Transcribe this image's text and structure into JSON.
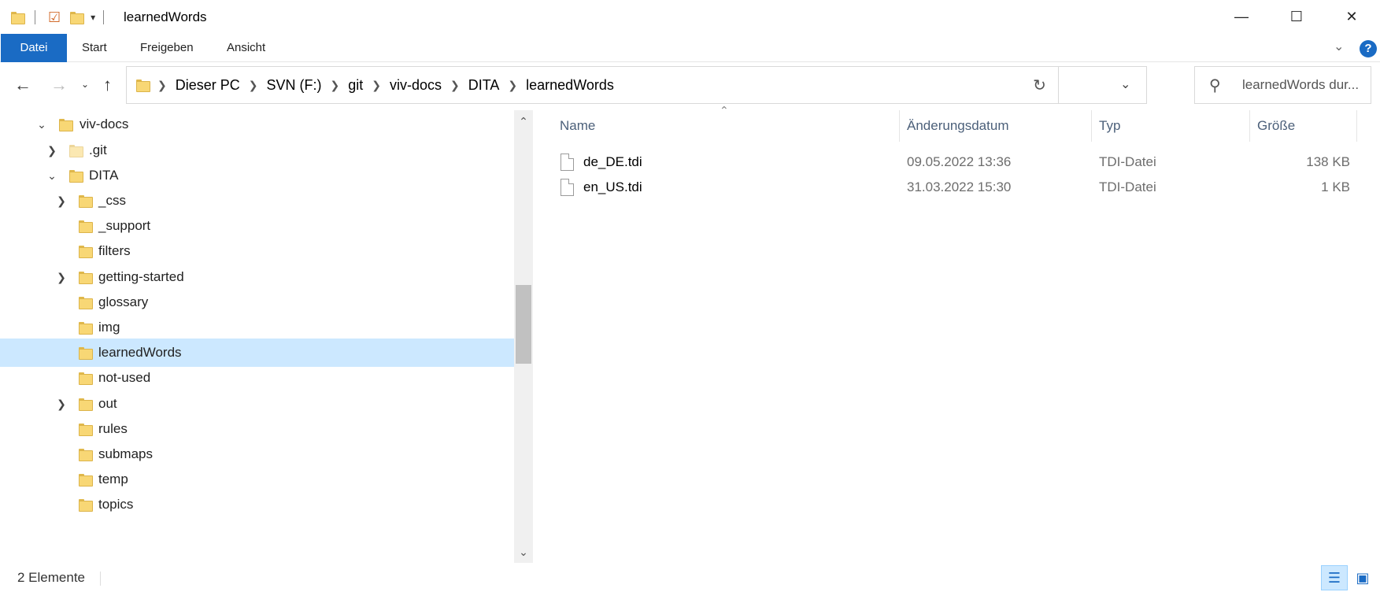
{
  "window": {
    "title": "learnedWords",
    "minimize_glyph": "—",
    "maximize_glyph": "☐",
    "close_glyph": "✕"
  },
  "ribbon": {
    "tabs": [
      {
        "label": "Datei",
        "active": true
      },
      {
        "label": "Start",
        "active": false
      },
      {
        "label": "Freigeben",
        "active": false
      },
      {
        "label": "Ansicht",
        "active": false
      }
    ],
    "help_label": "?"
  },
  "address": {
    "crumbs": [
      "Dieser PC",
      "SVN (F:)",
      "git",
      "viv-docs",
      "DITA",
      "learnedWords"
    ]
  },
  "search": {
    "placeholder": "learnedWords dur..."
  },
  "tree": [
    {
      "label": "viv-docs",
      "expander": "expanded"
    },
    {
      "label": ".git",
      "expander": "collapsed"
    },
    {
      "label": "DITA",
      "expander": "expanded"
    },
    {
      "label": "_css",
      "expander": "collapsed"
    },
    {
      "label": "_support",
      "expander": "none"
    },
    {
      "label": "filters",
      "expander": "none"
    },
    {
      "label": "getting-started",
      "expander": "collapsed"
    },
    {
      "label": "glossary",
      "expander": "none"
    },
    {
      "label": "img",
      "expander": "none"
    },
    {
      "label": "learnedWords",
      "expander": "none",
      "selected": true
    },
    {
      "label": "not-used",
      "expander": "none"
    },
    {
      "label": "out",
      "expander": "collapsed"
    },
    {
      "label": "rules",
      "expander": "none"
    },
    {
      "label": "submaps",
      "expander": "none"
    },
    {
      "label": "temp",
      "expander": "none"
    },
    {
      "label": "topics",
      "expander": "none"
    }
  ],
  "files": {
    "columns": [
      "Name",
      "Änderungsdatum",
      "Typ",
      "Größe"
    ],
    "rows": [
      {
        "name": "de_DE.tdi",
        "date": "09.05.2022 13:36",
        "type": "TDI-Datei",
        "size": "138 KB"
      },
      {
        "name": "en_US.tdi",
        "date": "31.03.2022 15:30",
        "type": "TDI-Datei",
        "size": "1 KB"
      }
    ]
  },
  "status": {
    "count": "2 Elemente"
  },
  "colors": {
    "accent": "#1a6bc4",
    "selection": "#cce8ff",
    "folder": "#f8d775"
  }
}
